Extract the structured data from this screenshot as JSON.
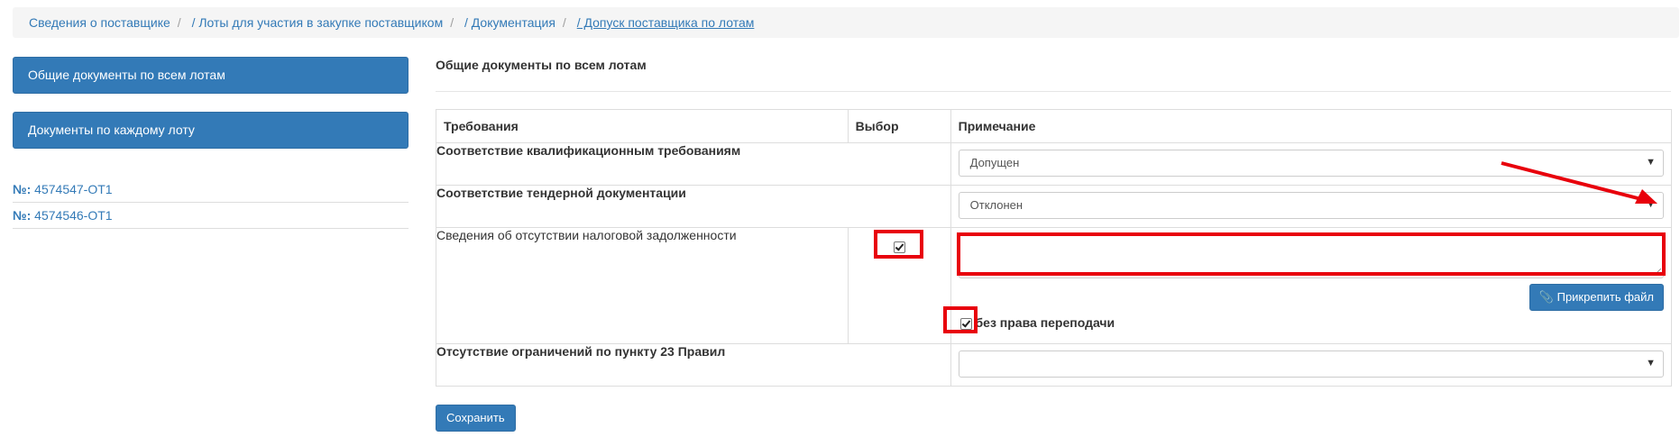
{
  "breadcrumb": {
    "items": [
      {
        "label": "Сведения о поставщике"
      },
      {
        "label": "/ Лоты для участия в закупке поставщиком"
      },
      {
        "label": "/ Документация"
      },
      {
        "label": "/ Допуск поставщика по лотам"
      }
    ],
    "separator": "/"
  },
  "sidebar": {
    "common_docs_button": "Общие документы по всем лотам",
    "per_lot_docs_button": "Документы по каждому лоту",
    "lots": [
      {
        "prefix": "№:",
        "number": "4574547-ОТ1"
      },
      {
        "prefix": "№:",
        "number": "4574546-ОТ1"
      }
    ]
  },
  "main": {
    "title": "Общие документы по всем лотам",
    "table": {
      "headers": [
        "Требования",
        "Выбор",
        "Примечание"
      ],
      "rows": [
        {
          "requirement": "Соответствие квалификационным требованиям",
          "select_value": "Допущен"
        },
        {
          "requirement": "Соответствие тендерной документации",
          "select_value": "Отклонен"
        },
        {
          "requirement": "Сведения об отсутствии налоговой задолженности",
          "checked": true,
          "textarea_value": "",
          "attach_label": "Прикрепить файл",
          "no_resale_label": "без права переподачи",
          "no_resale_checked": true
        },
        {
          "requirement": "Отсутствие ограничений по пункту 23 Правил",
          "select_value": ""
        }
      ]
    },
    "save_button": "Сохранить"
  },
  "icons": {
    "caret": "caret-down-icon",
    "paperclip": "paperclip-icon",
    "check": "checkmark-icon"
  },
  "colors": {
    "primary": "#337ab7",
    "annotation": "#e8000b",
    "breadcrumb_bg": "#f5f5f5"
  }
}
